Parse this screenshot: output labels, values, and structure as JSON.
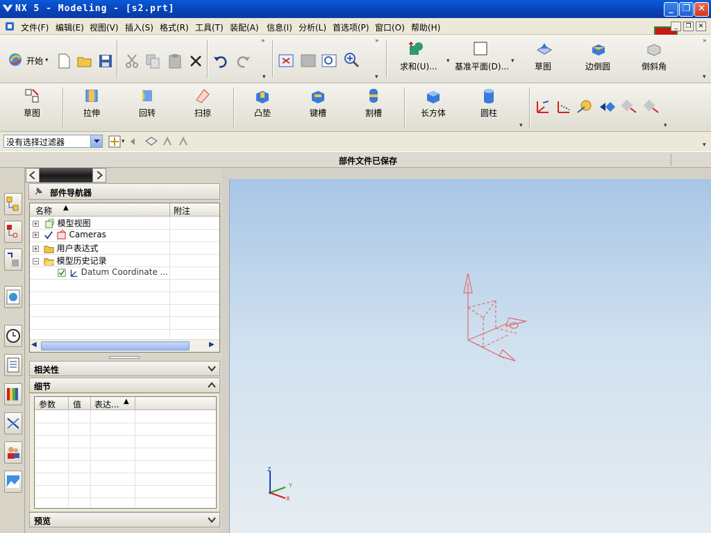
{
  "window": {
    "title": "NX 5 - Modeling - [s2.prt]",
    "controls": [
      "_",
      "❐",
      "✕"
    ]
  },
  "menubar": {
    "items": [
      "文件(F)",
      "编辑(E)",
      "视图(V)",
      "插入(S)",
      "格式(R)",
      "工具(T)",
      "装配(A)",
      "信息(I)",
      "分析(L)",
      "首选项(P)",
      "窗口(O)",
      "帮助(H)"
    ]
  },
  "toolbar1": {
    "start_label": "开始",
    "feature_buttons": [
      "求和(U)...",
      "基准平面(D)...",
      "草图",
      "边倒圆",
      "倒斜角"
    ]
  },
  "toolbar2": {
    "buttons": [
      "草图",
      "拉伸",
      "回转",
      "扫掠",
      "凸垫",
      "键槽",
      "割槽",
      "长方体",
      "圆柱"
    ]
  },
  "filter": {
    "value": "没有选择过滤器"
  },
  "status": {
    "message": "部件文件已保存"
  },
  "navigator": {
    "title": "部件导航器",
    "columns": [
      "名称",
      "附注"
    ],
    "tree": [
      {
        "label": "模型视图",
        "expander": "+"
      },
      {
        "label": "Cameras",
        "expander": "+"
      },
      {
        "label": "用户表达式",
        "expander": "+"
      },
      {
        "label": "模型历史记录",
        "expander": "−"
      },
      {
        "label": "Datum Coordinate ...",
        "expander": ""
      }
    ]
  },
  "panels": {
    "dependencies": "相关性",
    "details": "细节",
    "details_columns": [
      "参数",
      "值",
      "表达..."
    ],
    "preview": "预览"
  },
  "axes": {
    "z": "Z",
    "y": "Y",
    "x": "X"
  },
  "colors": {
    "titlebar": "#0842b6",
    "datum": "#e06a6a",
    "viewport_top": "#a7c6e6",
    "viewport_bottom": "#e6edf2"
  }
}
